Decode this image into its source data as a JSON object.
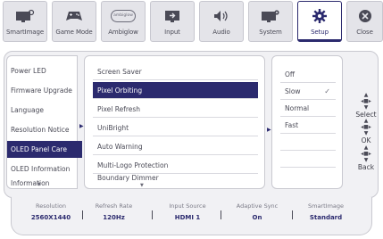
{
  "tabs": [
    {
      "label": "SmartImage",
      "icon": "smartimage-icon"
    },
    {
      "label": "Game Mode",
      "icon": "gamepad-icon"
    },
    {
      "label": "Ambiglow",
      "icon": "ambiglow-icon",
      "icon_text": "ambiglow"
    },
    {
      "label": "Input",
      "icon": "input-icon"
    },
    {
      "label": "Audio",
      "icon": "speaker-icon"
    },
    {
      "label": "System",
      "icon": "system-icon"
    },
    {
      "label": "Setup",
      "icon": "gear-icon",
      "active": true
    },
    {
      "label": "Close",
      "icon": "close-icon"
    }
  ],
  "menu_level1": [
    {
      "label": "Power LED"
    },
    {
      "label": "Firmware Upgrade"
    },
    {
      "label": "Language"
    },
    {
      "label": "Resolution Notice"
    },
    {
      "label": "OLED Panel Care",
      "selected": true
    },
    {
      "label": "OLED Information"
    },
    {
      "label": "Information"
    }
  ],
  "menu_level2": [
    {
      "label": "Screen Saver"
    },
    {
      "label": "Pixel Orbiting",
      "selected": true
    },
    {
      "label": "Pixel Refresh"
    },
    {
      "label": "UniBright"
    },
    {
      "label": "Auto Warning"
    },
    {
      "label": "Multi-Logo Protection"
    },
    {
      "label": "Boundary Dimmer"
    }
  ],
  "menu_level3": [
    {
      "label": "Off"
    },
    {
      "label": "Slow",
      "checked": true
    },
    {
      "label": "Normal"
    },
    {
      "label": "Fast"
    },
    {
      "label": ""
    },
    {
      "label": ""
    },
    {
      "label": ""
    }
  ],
  "controls": {
    "select": "Select",
    "ok": "OK",
    "back": "Back"
  },
  "status": [
    {
      "key": "Resolution",
      "value": "2560X1440"
    },
    {
      "key": "Refresh Rate",
      "value": "120Hz"
    },
    {
      "key": "Input Source",
      "value": "HDMI 1"
    },
    {
      "key": "Adaptive Sync",
      "value": "On"
    },
    {
      "key": "SmartImage",
      "value": "Standard"
    }
  ],
  "colors": {
    "accent": "#2b2a6e",
    "tab_bg": "#e4e4e9",
    "panel_bg": "#f1f1f4"
  }
}
